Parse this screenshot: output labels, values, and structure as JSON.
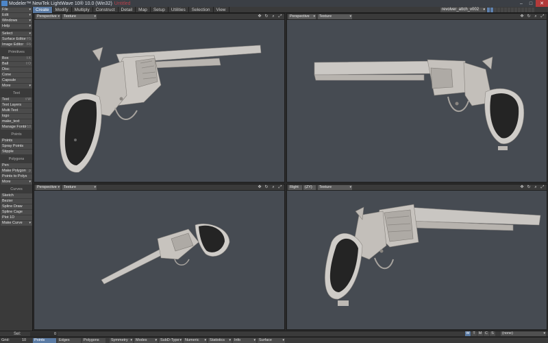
{
  "titlebar": {
    "title": "Modeler™ NewTek LightWave 10® 10.0 (Win32)",
    "suffix": "Untitled",
    "min": "–",
    "max": "□",
    "close": "✕"
  },
  "menu": {
    "tabs": [
      "Create",
      "Modify",
      "Multiply",
      "Construct",
      "Detail",
      "Map",
      "Setup",
      "Utilities",
      "Selection",
      "View"
    ],
    "active_index": 0,
    "object": "revolver_attch_v002",
    "dd_glyph": "▾"
  },
  "toolbar": {
    "top": [
      {
        "label": "File",
        "arrow": "▾"
      },
      {
        "label": "Edit",
        "arrow": "▾"
      },
      {
        "label": "Windows",
        "arrow": "▾"
      },
      {
        "label": "Help",
        "arrow": "▾"
      },
      {
        "label": "Select",
        "arrow": "▾"
      },
      {
        "label": "Surface Editor",
        "key": "F5"
      },
      {
        "label": "Image Editor",
        "key": "F6"
      }
    ],
    "primitives_header": "Primitives",
    "primitives": [
      {
        "label": "Box",
        "key": "⇧X"
      },
      {
        "label": "Ball",
        "key": "⇧O"
      },
      {
        "label": "Disc",
        "key": ""
      },
      {
        "label": "Cone",
        "key": ""
      },
      {
        "label": "Capsule",
        "key": ""
      },
      {
        "label": "More",
        "arrow": "▾"
      }
    ],
    "text_header": "Text",
    "text": [
      {
        "label": "Text",
        "key": "⇧W"
      },
      {
        "label": "Text Layers",
        "key": ""
      },
      {
        "label": "Multi Text",
        "key": ""
      },
      {
        "label": "logo",
        "key": ""
      },
      {
        "label": "make_text",
        "key": ""
      },
      {
        "label": "Manage Fonts",
        "key": "F10"
      }
    ],
    "points_header": "Points",
    "points": [
      {
        "label": "Points",
        "key": ""
      },
      {
        "label": "Spray Points",
        "key": ""
      },
      {
        "label": "Stipple",
        "key": ""
      }
    ],
    "polygons_header": "Polygons",
    "polygons": [
      {
        "label": "Pen",
        "key": ""
      },
      {
        "label": "Make Polygon",
        "key": "p"
      },
      {
        "label": "Points to Polys",
        "key": ""
      },
      {
        "label": "More",
        "arrow": "▾"
      }
    ],
    "curves_header": "Curves",
    "curves": [
      {
        "label": "Sketch",
        "key": ""
      },
      {
        "label": "Bezier",
        "key": ""
      },
      {
        "label": "Spline Draw",
        "key": ""
      },
      {
        "label": "Spline Cage",
        "key": ""
      },
      {
        "label": "Plot 1D",
        "key": ""
      },
      {
        "label": "Make Curve",
        "arrow": "▾"
      }
    ]
  },
  "viewports": [
    {
      "view": "Perspective",
      "shading": "Texture"
    },
    {
      "view": "Perspective",
      "shading": "Texture"
    },
    {
      "view": "Perspective",
      "shading": "Texture"
    },
    {
      "view": "Right",
      "axis": "(ZY)",
      "shading": "Texture"
    }
  ],
  "viewport_icons": [
    "✥",
    "↻",
    "⌕",
    "⤢"
  ],
  "sel_bar": {
    "label": "Sel:",
    "count": "0",
    "wtmcs": [
      "W",
      "T",
      "M",
      "C",
      "S"
    ],
    "active_index": 0,
    "none": "(none)"
  },
  "status": {
    "grid_label": "Grid:",
    "grid_value": "10 cm",
    "modes": [
      "Points",
      "Edges",
      "Polygons"
    ],
    "active_mode": 0,
    "buttons": [
      "Symmetry",
      "Modes",
      "SubD-Type",
      "Numeric",
      "Statistics",
      "Info",
      "Surface"
    ]
  },
  "colors": {
    "accent": "#5a7aa3",
    "viewport_bg": "#464b52",
    "metal": "#c8c4bf",
    "grip": "#222222"
  }
}
